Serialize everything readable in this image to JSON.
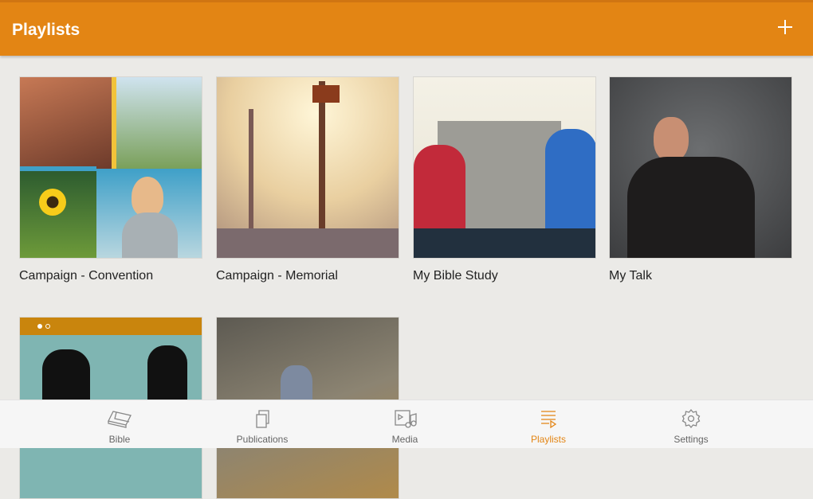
{
  "header": {
    "title": "Playlists",
    "add_icon": "plus-icon"
  },
  "playlists": [
    {
      "label": "Campaign - Convention"
    },
    {
      "label": "Campaign - Memorial"
    },
    {
      "label": "My Bible Study"
    },
    {
      "label": "My Talk"
    },
    {
      "label": ""
    },
    {
      "label": ""
    }
  ],
  "nav": {
    "items": [
      {
        "label": "Bible",
        "icon": "book-icon"
      },
      {
        "label": "Publications",
        "icon": "publications-icon"
      },
      {
        "label": "Media",
        "icon": "media-icon"
      },
      {
        "label": "Playlists",
        "icon": "playlist-icon",
        "active": true
      },
      {
        "label": "Settings",
        "icon": "gear-icon"
      }
    ]
  },
  "colors": {
    "accent": "#e38514",
    "background": "#ebeae7"
  }
}
